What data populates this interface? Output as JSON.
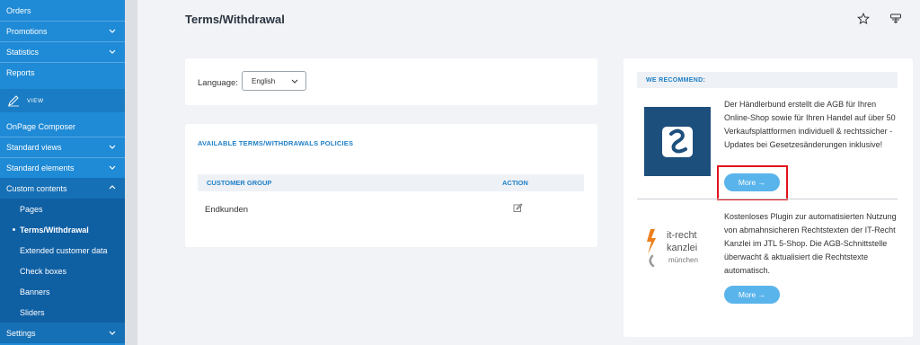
{
  "sidebar": {
    "top_items": [
      {
        "label": "Orders"
      },
      {
        "label": "Promotions"
      },
      {
        "label": "Statistics"
      },
      {
        "label": "Reports"
      }
    ],
    "section_label": "VIEW",
    "view_items": [
      {
        "label": "OnPage Composer"
      },
      {
        "label": "Standard views"
      },
      {
        "label": "Standard elements"
      },
      {
        "label": "Custom contents"
      }
    ],
    "sub_items": [
      {
        "label": "Pages"
      },
      {
        "label": "Terms/Withdrawal"
      },
      {
        "label": "Extended customer data"
      },
      {
        "label": "Check boxes"
      },
      {
        "label": "Banners"
      },
      {
        "label": "Sliders"
      }
    ],
    "bottom_item": {
      "label": "Settings"
    }
  },
  "header": {
    "title": "Terms/Withdrawal"
  },
  "language": {
    "label": "Language:",
    "selected": "English"
  },
  "policies": {
    "title": "AVAILABLE TERMS/WITHDRAWALS POLICIES",
    "columns": [
      "CUSTOMER GROUP",
      "ACTION"
    ],
    "rows": [
      {
        "customer_group": "Endkunden"
      }
    ]
  },
  "recommend": {
    "title": "WE RECOMMEND:",
    "items": [
      {
        "logo": "haendlerbund-logo",
        "text": "Der Händlerbund erstellt die AGB für Ihren Online-Shop sowie für Ihren Handel auf über 50 Verkaufsplattformen individuell & rechtssicher - Updates bei Gesetzesänderungen inklusive!",
        "button": "More →"
      },
      {
        "logo": "it-recht-kanzlei-logo",
        "logo_text": [
          "it-recht",
          "kanzlei",
          "münchen"
        ],
        "text": "Kostenloses Plugin zur automatisierten Nutzung von abmahnsicheren Rechtstexten der IT-Recht Kanzlei im JTL 5-Shop. Die AGB-Schnittstelle überwacht & aktualisiert die Rechtstexte automatisch.",
        "button": "More →"
      }
    ]
  },
  "colors": {
    "sidebar": "#1f8ad6",
    "sidebar_sub": "#0f5fa3",
    "accent": "#1f7fc7",
    "button": "#5ab4ec",
    "highlight": "#e0141b"
  }
}
